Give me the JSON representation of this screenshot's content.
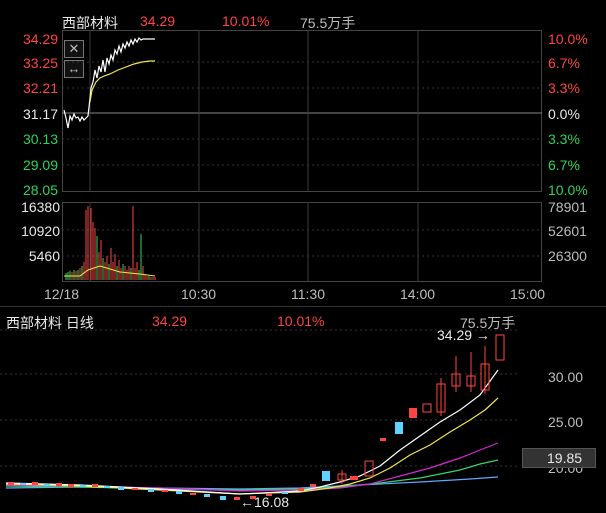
{
  "intraday": {
    "name": "西部材料",
    "price": "34.29",
    "change_pct": "10.01%",
    "volume": "75.5万手",
    "price_axis_left": [
      "34.29",
      "33.25",
      "32.21",
      "31.17",
      "30.13",
      "29.09",
      "28.05"
    ],
    "pct_axis_right": [
      "10.0%",
      "6.7%",
      "3.3%",
      "0.0%",
      "3.3%",
      "6.7%",
      "10.0%"
    ],
    "volume_axis_left": [
      "16380",
      "10920",
      "5460"
    ],
    "volume_axis_right": [
      "78901",
      "52601",
      "26300"
    ],
    "time_axis": [
      "12/18",
      "10:30",
      "11:30",
      "14:00",
      "15:00"
    ],
    "icons": [
      "close-icon",
      "expand-icon"
    ]
  },
  "daily": {
    "title": "西部材料 日线",
    "price": "34.29",
    "change_pct": "10.01%",
    "volume": "75.5万手",
    "price_axis": [
      "30.00",
      "25.00",
      "20.00"
    ],
    "current_price_tag": "19.85",
    "high_marker": "34.29",
    "low_marker": "16.08"
  },
  "colors": {
    "up": "#ff4444",
    "down": "#2fd35a",
    "price_line": "#ffffff",
    "avg_line": "#f2e64a",
    "ma_magenta": "#d22ad2",
    "ma_green": "#39d36a",
    "ma_blue": "#5fa8ff"
  }
}
